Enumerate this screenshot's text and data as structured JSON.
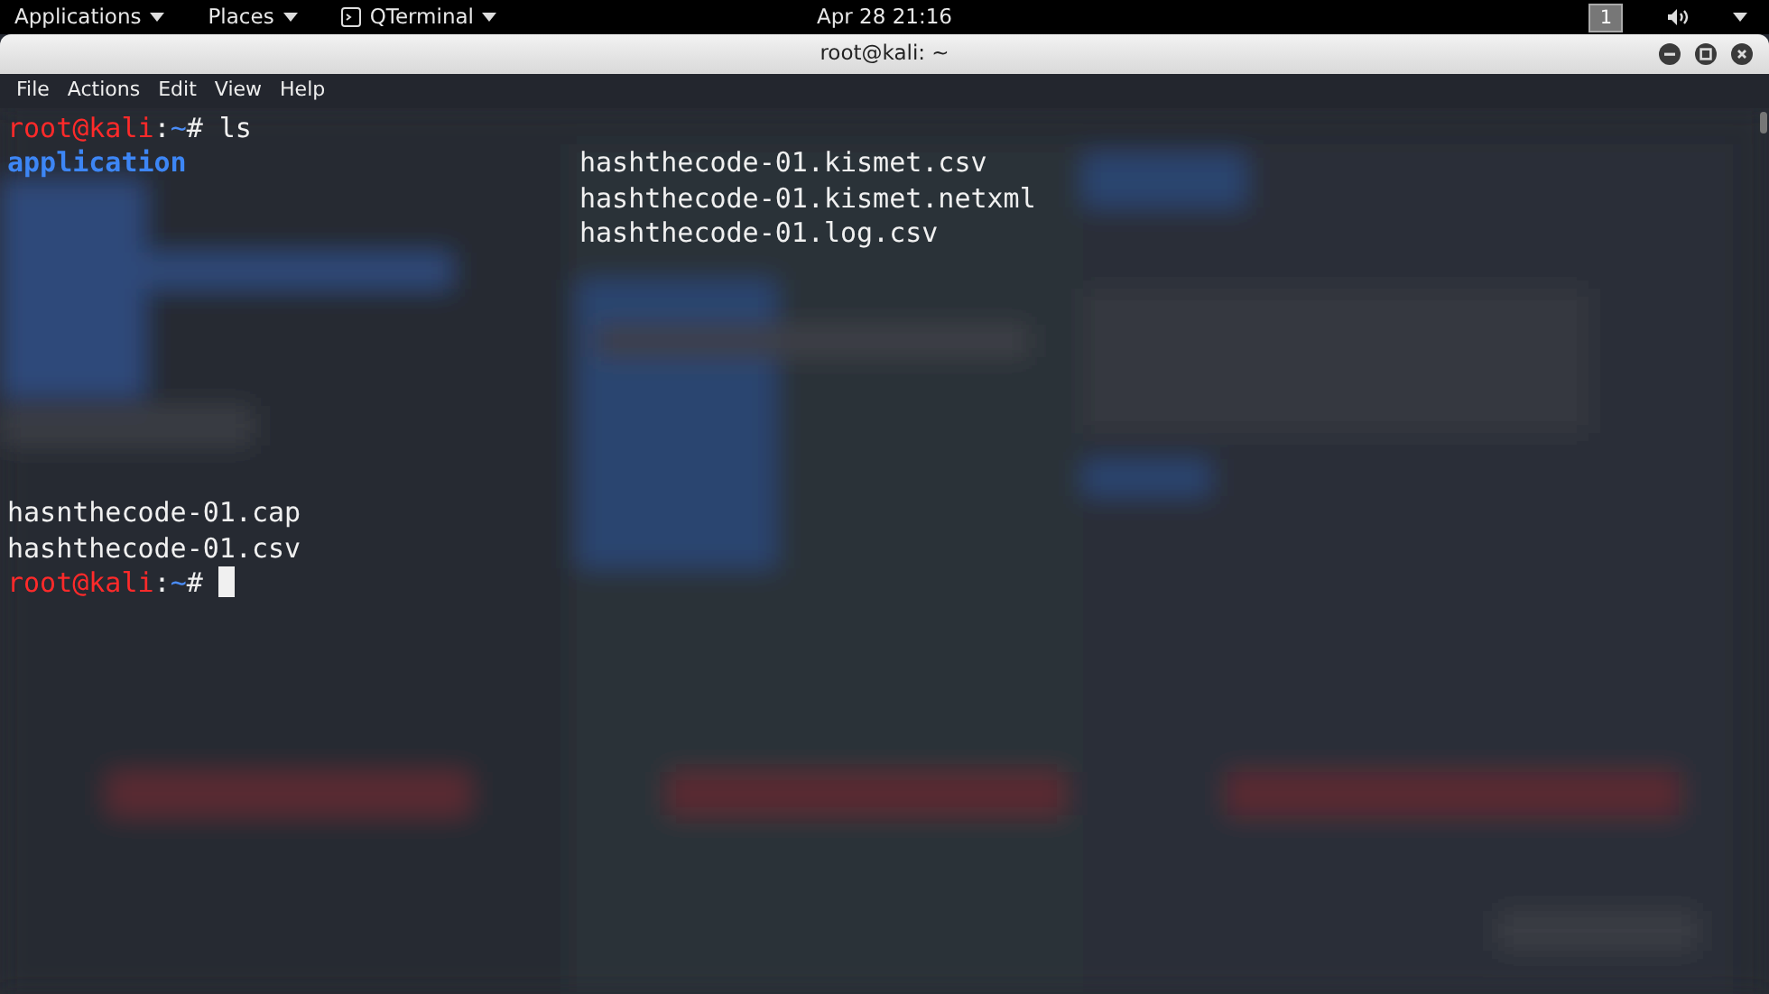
{
  "top_bar": {
    "menus": [
      {
        "label": "Applications",
        "kind": "menu"
      },
      {
        "label": "Places",
        "kind": "menu"
      },
      {
        "label": "QTerminal",
        "kind": "app"
      }
    ],
    "clock": "Apr 28  21:16",
    "workspace": "1"
  },
  "window": {
    "title": "root@kali: ~"
  },
  "menu_bar": [
    "File",
    "Actions",
    "Edit",
    "View",
    "Help"
  ],
  "terminal": {
    "lines": [
      {
        "col1": [
          {
            "text": "root@kali",
            "kind": "user"
          },
          {
            "text": ":",
            "kind": "plain"
          },
          {
            "text": "~",
            "kind": "path"
          },
          {
            "text": "# ls",
            "kind": "plain"
          }
        ]
      },
      {
        "col1": [
          {
            "text": "application",
            "kind": "dir"
          }
        ],
        "col2": [
          {
            "text": "hashthecode-01.kismet.csv",
            "kind": "plain"
          }
        ]
      },
      {
        "col2": [
          {
            "text": "hashthecode-01.kismet.netxml",
            "kind": "plain"
          }
        ]
      },
      {
        "col2": [
          {
            "text": "hashthecode-01.log.csv",
            "kind": "plain"
          }
        ]
      },
      {
        "col1": [
          {
            "text": "hasnthecode-01.cap",
            "kind": "plain"
          }
        ],
        "gap_before": true
      },
      {
        "col1": [
          {
            "text": "hashthecode-01.csv",
            "kind": "plain"
          }
        ]
      },
      {
        "col1": [
          {
            "text": "root@kali",
            "kind": "user"
          },
          {
            "text": ":",
            "kind": "plain"
          },
          {
            "text": "~",
            "kind": "path"
          },
          {
            "text": "# ",
            "kind": "plain"
          }
        ],
        "cursor": true
      }
    ]
  }
}
